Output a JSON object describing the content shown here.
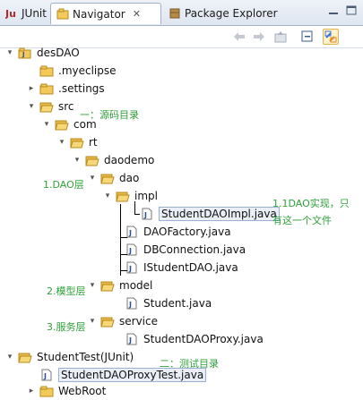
{
  "tabs": [
    {
      "label": "JUnit",
      "icon": "junit-icon"
    },
    {
      "label": "Navigator",
      "icon": "navigator-icon",
      "active": true,
      "close": "✕"
    },
    {
      "label": "Package Explorer",
      "icon": "package-explorer-icon"
    }
  ],
  "toolbar": {
    "back_icon": "back-arrow-icon",
    "forward_icon": "forward-arrow-icon",
    "up_icon": "up-folder-icon",
    "collapse_icon": "collapse-all-icon",
    "link_icon": "link-with-editor-icon"
  },
  "tree": [
    {
      "label": "desDAO",
      "icon": "project-icon",
      "expanded": true
    },
    {
      "label": ".myeclipse",
      "icon": "folder-icon"
    },
    {
      "label": ".settings",
      "icon": "folder-icon",
      "collapsed": true
    },
    {
      "label": "src",
      "icon": "folder-open-icon",
      "expanded": true
    },
    {
      "label": "com",
      "icon": "folder-open-icon",
      "expanded": true
    },
    {
      "label": "rt",
      "icon": "folder-open-icon",
      "expanded": true
    },
    {
      "label": "daodemo",
      "icon": "folder-open-icon",
      "expanded": true
    },
    {
      "label": "dao",
      "icon": "folder-open-icon",
      "expanded": true
    },
    {
      "label": "impl",
      "icon": "folder-open-icon",
      "expanded": true
    },
    {
      "label": "StudentDAOImpl.java",
      "icon": "java-file-icon",
      "selected": true
    },
    {
      "label": "DAOFactory.java",
      "icon": "java-file-icon"
    },
    {
      "label": "DBConnection.java",
      "icon": "java-file-icon"
    },
    {
      "label": "IStudentDAO.java",
      "icon": "java-file-icon"
    },
    {
      "label": "model",
      "icon": "folder-open-icon",
      "expanded": true
    },
    {
      "label": "Student.java",
      "icon": "java-file-icon"
    },
    {
      "label": "service",
      "icon": "folder-open-icon",
      "expanded": true
    },
    {
      "label": "StudentDAOProxy.java",
      "icon": "java-file-icon"
    },
    {
      "label": "StudentTest(JUnit)",
      "icon": "folder-open-icon",
      "expanded": true
    },
    {
      "label": "StudentDAOProxyTest.java",
      "icon": "java-file-icon",
      "highlighted": true
    },
    {
      "label": "WebRoot",
      "icon": "folder-icon",
      "collapsed": true
    }
  ],
  "annotations": {
    "src_note": "一：源码目录",
    "dao_layer": "1.DAO层",
    "impl_note_line1": "1.1DAO实现，只",
    "impl_note_line2": "有这一个文件",
    "model_layer": "2.模型层",
    "service_layer": "3.服务层",
    "test_note": "二：测试目录"
  },
  "colors": {
    "annotation_green": "#2fa23a",
    "folder_yellow": "#f3c95a",
    "selection_border": "#9bb0d3"
  }
}
